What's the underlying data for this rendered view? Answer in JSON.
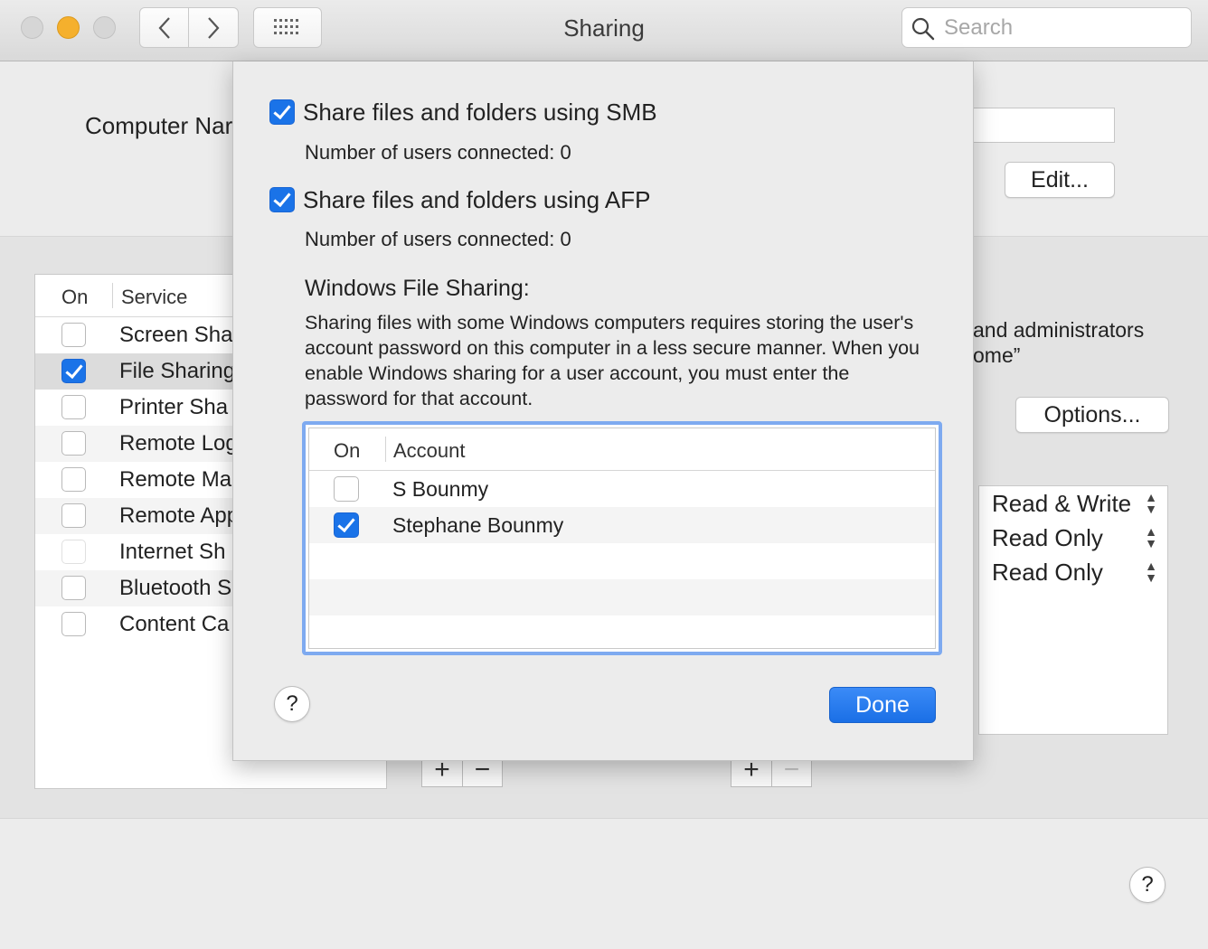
{
  "window": {
    "title": "Sharing"
  },
  "toolbar": {
    "search_placeholder": "Search"
  },
  "background": {
    "computer_name_label": "Computer Nar",
    "edit_button": "Edit...",
    "options_button": "Options...",
    "partial_text_line1": "and administrators",
    "partial_text_line2": "ome”",
    "services_header": {
      "on": "On",
      "service": "Service"
    },
    "services": [
      {
        "label": "Screen Sha",
        "checked": false
      },
      {
        "label": "File Sharing",
        "checked": true
      },
      {
        "label": "Printer Sha",
        "checked": false
      },
      {
        "label": "Remote Log",
        "checked": false
      },
      {
        "label": "Remote Ma",
        "checked": false
      },
      {
        "label": "Remote App",
        "checked": false
      },
      {
        "label": "Internet Sh",
        "checked": false
      },
      {
        "label": "Bluetooth S",
        "checked": false
      },
      {
        "label": "Content Ca",
        "checked": false
      }
    ],
    "permissions": [
      "Read & Write",
      "Read Only",
      "Read Only"
    ],
    "plus": "+",
    "minus": "−",
    "help": "?"
  },
  "sheet": {
    "smb_label": "Share files and folders using SMB",
    "smb_checked": true,
    "smb_users": "Number of users connected: 0",
    "afp_label": "Share files and folders using AFP",
    "afp_checked": true,
    "afp_users": "Number of users connected: 0",
    "windows_heading": "Windows File Sharing:",
    "windows_text": "Sharing files with some Windows computers requires storing the user's account password on this computer in a less secure manner. When you enable Windows sharing for a user account, you must enter the password for that account.",
    "table_header": {
      "on": "On",
      "account": "Account"
    },
    "accounts": [
      {
        "name": "S Bounmy",
        "checked": false
      },
      {
        "name": "Stephane Bounmy",
        "checked": true
      }
    ],
    "done_button": "Done",
    "help": "?"
  },
  "colors": {
    "accent": "#1a73e8",
    "focus_ring": "#7eaaf0"
  },
  "icons": [
    "chevron-left-icon",
    "chevron-right-icon",
    "grid-icon",
    "search-icon",
    "checkmark-icon",
    "stepper-icon",
    "help-icon"
  ]
}
